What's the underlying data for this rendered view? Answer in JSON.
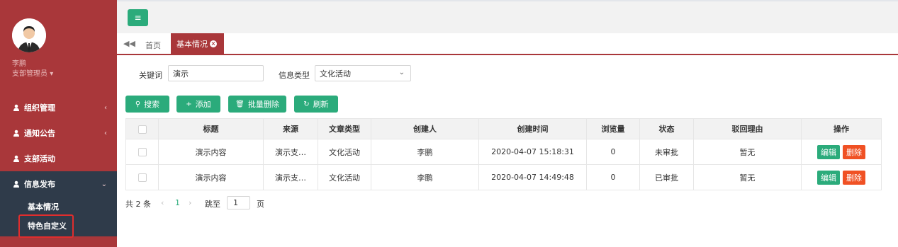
{
  "sidebar": {
    "user_name": "李鹏",
    "user_role": "支部管理员",
    "menu": [
      {
        "label": "组织管理",
        "chevron": "‹"
      },
      {
        "label": "通知公告",
        "chevron": "‹"
      },
      {
        "label": "支部活动",
        "chevron": ""
      },
      {
        "label": "信息发布",
        "chevron": "⌄"
      }
    ],
    "submenu": [
      {
        "label": "基本情况"
      },
      {
        "label": "特色自定义"
      }
    ]
  },
  "tabs": {
    "home": "首页",
    "active": "基本情况"
  },
  "filters": {
    "keyword_label": "关键词",
    "keyword_value": "演示",
    "type_label": "信息类型",
    "type_value": "文化活动"
  },
  "toolbar": {
    "search": "搜索",
    "add": "添加",
    "batch_delete": "批量删除",
    "refresh": "刷新"
  },
  "table": {
    "headers": [
      "标题",
      "来源",
      "文章类型",
      "创建人",
      "创建时间",
      "浏览量",
      "状态",
      "驳回理由",
      "操作"
    ],
    "rows": [
      {
        "title": "演示内容",
        "source": "演示支…",
        "type": "文化活动",
        "creator": "李鹏",
        "created": "2020-04-07 15:18:31",
        "views": "0",
        "status": "未审批",
        "reason": "暂无",
        "edit": "编辑",
        "delete": "删除"
      },
      {
        "title": "演示内容",
        "source": "演示支…",
        "type": "文化活动",
        "creator": "李鹏",
        "created": "2020-04-07 14:49:48",
        "views": "0",
        "status": "已审批",
        "reason": "暂无",
        "edit": "编辑",
        "delete": "删除"
      }
    ]
  },
  "pagination": {
    "total": "共 2 条",
    "current_page": "1",
    "jump_label": "跳至",
    "jump_value": "1",
    "page_unit": "页"
  },
  "colors": {
    "sidebar": "#a9373a",
    "submenu": "#2f3b4a",
    "primary": "#2bab7b",
    "danger": "#f05124"
  }
}
